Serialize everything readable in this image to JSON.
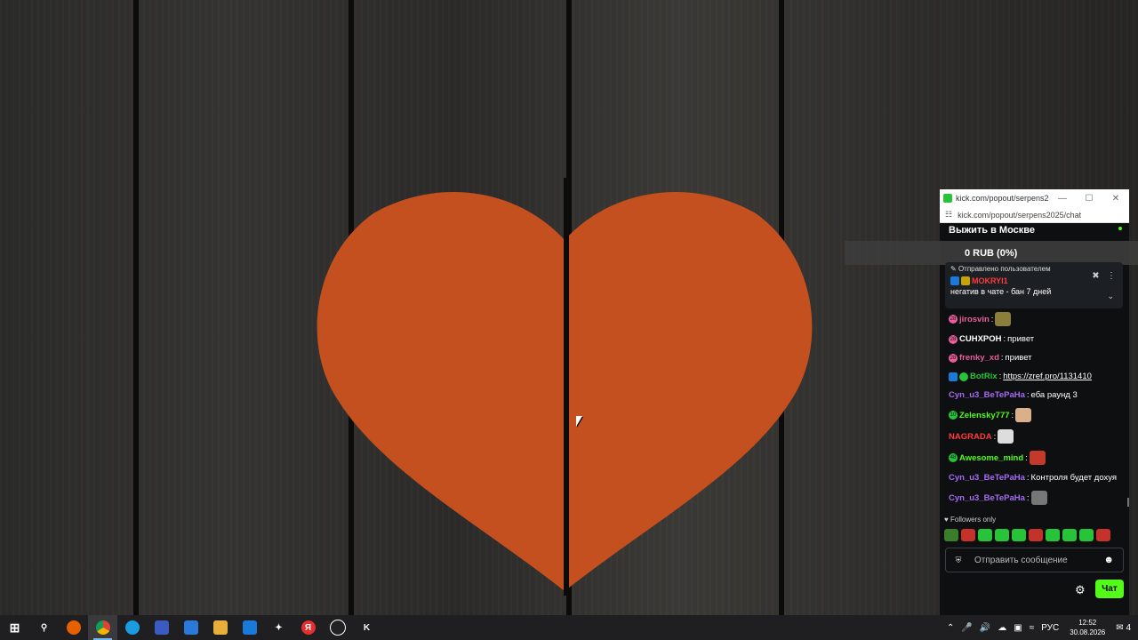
{
  "popup": {
    "tab_title": "kick.com/popout/serpens20...",
    "url": "kick.com/popout/serpens2025/chat",
    "chat_title": "Выжить в Москве",
    "donation": "0 RUB (0%)",
    "pinned": {
      "label": "Отправлено пользователем",
      "user": "MOKRYI1",
      "message": "негатив в чате - бан 7 дней"
    },
    "messages": [
      {
        "badge": "sub",
        "badge_text": "28",
        "user": "jirosvin",
        "color": "#e85d9a",
        "text": "",
        "emote": "#8b7d3a"
      },
      {
        "badge": "sub",
        "badge_text": "28",
        "user": "CUHXPOH",
        "color": "#ffffff",
        "text": "привет",
        "emote": ""
      },
      {
        "badge": "sub",
        "badge_text": "28",
        "user": "frenky_xd",
        "color": "#e85d9a",
        "text": "привет",
        "emote": ""
      },
      {
        "badge": "bot",
        "badge_text": "",
        "user": "BotRix",
        "color": "#27c43a",
        "text": "",
        "link": "https://zref.pro/1131410"
      },
      {
        "badge": "",
        "badge_text": "",
        "user": "Cyn_u3_BeTePaHa",
        "color": "#a56cf3",
        "text": "еба раунд 3",
        "emote": ""
      },
      {
        "badge": "green",
        "badge_text": "10",
        "user": "Zelensky777",
        "color": "#53fc18",
        "text": "",
        "emote": "#d9b08a"
      },
      {
        "badge": "",
        "badge_text": "",
        "user": "NAGRADA",
        "color": "#ff3b3b",
        "text": "",
        "emote": "#dddddd"
      },
      {
        "badge": "green",
        "badge_text": "48",
        "user": "Awesome_mind",
        "color": "#53fc18",
        "text": "",
        "emote": "#c43a2a"
      },
      {
        "badge": "",
        "badge_text": "",
        "user": "Cyn_u3_BeTePaHa",
        "color": "#a56cf3",
        "text": "Контроля будет дохуя",
        "emote": ""
      },
      {
        "badge": "",
        "badge_text": "",
        "user": "Cyn_u3_BeTePaHa",
        "color": "#a56cf3",
        "text": "",
        "emote": "#777777"
      }
    ],
    "followers_only": "Followers only",
    "input_placeholder": "Отправить сообщение",
    "send_label": "Чат",
    "emote_bar_colors": [
      "#3a7d2a",
      "#c4322a",
      "#27c43a",
      "#27c43a",
      "#27c43a",
      "#c4322a",
      "#27c43a",
      "#27c43a",
      "#27c43a",
      "#c4322a"
    ]
  },
  "taskbar": {
    "language": "РУС",
    "time": "12:52",
    "date": "30.08.2026",
    "notification_count": "4",
    "apps": [
      "windows-start",
      "search",
      "firefox",
      "chrome",
      "edge",
      "save",
      "store",
      "explorer",
      "mail",
      "sparkle",
      "yandex",
      "obs",
      "kick"
    ]
  },
  "colors": {
    "heart": "#c4501f",
    "kick_green": "#53fc18"
  }
}
